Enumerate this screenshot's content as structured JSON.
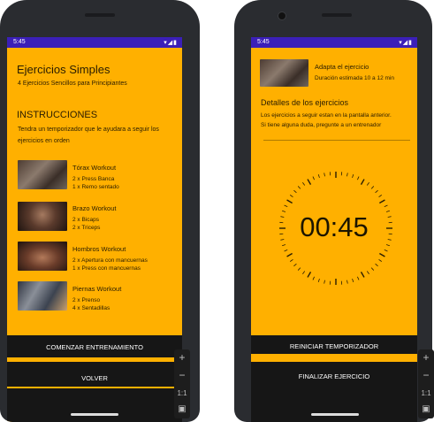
{
  "left": {
    "status": {
      "time": "5:45",
      "icons": "▾◢▮"
    },
    "title": "Ejercicios Simples",
    "subtitle": "4 Ejercicios Sencillos para Principiantes",
    "instructions_heading": "INSTRUCCIONES",
    "instructions_line1": "Tendra un temporizador que le ayudara a seguir los",
    "instructions_line2": "ejercicios en orden",
    "exercises": [
      {
        "name": "Tórax Workout",
        "line1": "2 x Press Banca",
        "line2": "1 x Remo sentado"
      },
      {
        "name": "Brazo Workout",
        "line1": "2 x Bicaps",
        "line2": "2 x Triceps"
      },
      {
        "name": "Hombros Workout",
        "line1": "2 x Apertura con mancuernas",
        "line2": "1 x Press con mancuernas"
      },
      {
        "name": "Piernas Workout",
        "line1": "2 x Prenso",
        "line2": "4 x Sentadillas"
      }
    ],
    "start_button": "COMENZAR ENTRENAMIENTO",
    "back_button": "VOLVER"
  },
  "right": {
    "status": {
      "time": "5:45",
      "icons": "▾◢▮"
    },
    "exercise_title": "Adapta el ejercicio",
    "duration": "Duración estimada 10 a 12 min",
    "details_heading": "Detalles de los ejercicios",
    "details_line1": "Los ejercicios a seguir estan en la pantalla anterior.",
    "details_line2": "Si tiene alguna duda, pregunte a un entrenador",
    "timer": "00:45",
    "reset_button": "REINICIAR TEMPORIZADOR",
    "finish_button": "FINALIZAR EJERCICIO"
  },
  "zoom_controls": {
    "plus": "+",
    "minus": "−",
    "ratio": "1:1"
  },
  "colors": {
    "screen_bg": "#ffb000",
    "status_bar": "#3b1fb8",
    "bottom_bar": "#161616"
  }
}
